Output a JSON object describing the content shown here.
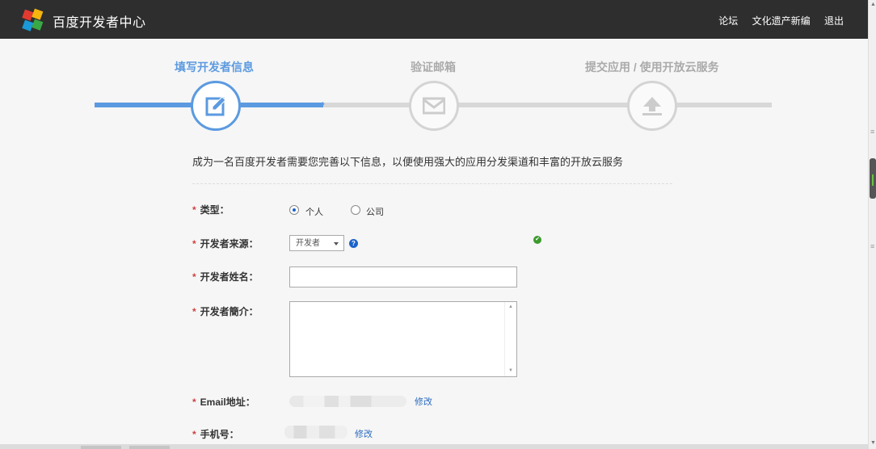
{
  "header": {
    "brand": "百度开发者中心",
    "nav": [
      "论坛",
      "文化遗产新编",
      "退出"
    ]
  },
  "steps": [
    {
      "label": "填写开发者信息",
      "icon": "edit-icon",
      "active": true
    },
    {
      "label": "验证邮箱",
      "icon": "mail-icon",
      "active": false
    },
    {
      "label": "提交应用 / 使用开放云服务",
      "icon": "upload-icon",
      "active": false
    }
  ],
  "progress": {
    "completed_fraction": 0.34
  },
  "intro": "成为一名百度开发者需要您完善以下信息，以便使用强大的应用分发渠道和丰富的开放云服务",
  "form": {
    "required_mark": "*",
    "type": {
      "label": "类型：",
      "options": [
        "个人",
        "公司"
      ],
      "selected": "个人"
    },
    "source": {
      "label": "开发者来源：",
      "value": "开发者",
      "help": "?",
      "ok": "✔"
    },
    "name": {
      "label": "开发者姓名：",
      "value": ""
    },
    "intro": {
      "label": "开发者簡介：",
      "value": ""
    },
    "email": {
      "label": "Email地址：",
      "edit": "修改"
    },
    "phone": {
      "label": "手机号：",
      "edit": "修改"
    }
  },
  "colors": {
    "accent": "#5b9ae0",
    "link": "#2d6cc0",
    "required": "#d04040",
    "success": "#3d9a2e"
  }
}
